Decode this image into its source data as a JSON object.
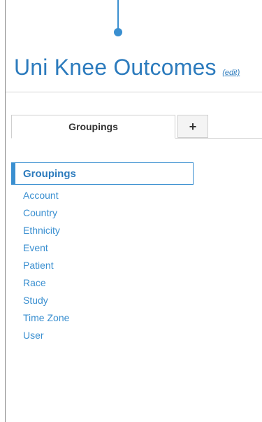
{
  "header": {
    "title": "Uni Knee Outcomes",
    "edit_label": "(edit)"
  },
  "tabs": [
    {
      "label": "Groupings",
      "active": true
    },
    {
      "label": "+",
      "icon": "plus-icon"
    }
  ],
  "groupings": {
    "heading": "Groupings",
    "items": [
      {
        "label": "Account"
      },
      {
        "label": "Country"
      },
      {
        "label": "Ethnicity"
      },
      {
        "label": "Event"
      },
      {
        "label": "Patient"
      },
      {
        "label": "Race"
      },
      {
        "label": "Study"
      },
      {
        "label": "Time Zone"
      },
      {
        "label": "User"
      }
    ]
  },
  "colors": {
    "accent": "#2c7bbd",
    "link": "#3a8fd0",
    "border": "#cfcfcf"
  }
}
